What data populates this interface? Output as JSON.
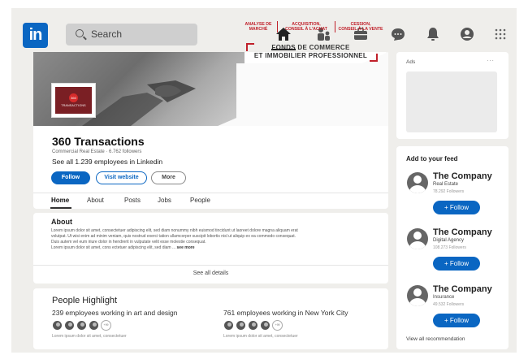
{
  "nav": {
    "logo_text": "in",
    "search_placeholder": "Search",
    "icons": [
      "home-icon",
      "my-network-icon",
      "jobs-icon",
      "messaging-icon",
      "notifications-icon",
      "profile-icon",
      "apps-grid-icon"
    ]
  },
  "banner": {
    "services": [
      "ANALYSE DE\nMARCHÉ",
      "ACQUISITION,\nCONSEIL À L'ACHAT",
      "CESSION,\nCONSEIL À LA VENTE"
    ],
    "headline_line1": "FONDS DE COMMERCE",
    "headline_line2": "ET IMMOBILIER PROFESSIONNEL"
  },
  "company": {
    "logo_mark": "360",
    "logo_word": "TRANSACTIONS",
    "name": "360 Transactions",
    "subtitle": "Commercial Real Estate · 6.762 followers",
    "employees_link": "See all 1.239 employees in Linkedin",
    "follow_label": "Follow",
    "visit_label": "Visit website",
    "more_label": "More"
  },
  "tabs": [
    "Home",
    "About",
    "Posts",
    "Jobs",
    "People"
  ],
  "about": {
    "title": "About",
    "line1": "Lorem ipsum dolor sit amet, consectetuer adipiscing elit, sed diam nonummy nibh euismod tincidunt ut laoreet dolore magna aliquam erat",
    "line2": "volutpat. Ut wisi enim ad minim veniam, quis nostrud exerci tation ullamcorper suscipit lobortis nisl ut aliquip ex ea commodo consequat.",
    "line3": "Duis autem vel eum iriure dolor in hendrerit in vulputate velit esse molestie consequat.",
    "line4": "Lorem ipsum dolor sit amet, cons ectetuer adipiscing elit, sed diam ...",
    "see_more": "see more",
    "see_all": "See all details"
  },
  "people": {
    "title": "People Highlight",
    "left_text": "239 employees working in art and design",
    "right_text": "761 employees working in New York City",
    "more_badge": "+99",
    "left_small": "Lorem ipsum dolor sit amet, consectetuer",
    "right_small": "Lorem ipsum dolor sit amet, consectetuer"
  },
  "ads": {
    "title": "Ads",
    "menu": "···"
  },
  "feed": {
    "title": "Add to your feed",
    "items": [
      {
        "name": "The Company",
        "category": "Real Estate",
        "followers": "78.292 Followers",
        "button": "+   Follow"
      },
      {
        "name": "The Company",
        "category": "Digital Agency",
        "followers": "108.273 Followers",
        "button": "+   Follow"
      },
      {
        "name": "The Company",
        "category": "Insurance",
        "followers": "49.532 Followers",
        "button": "+   Follow"
      }
    ],
    "view_all": "View all recommendation"
  },
  "colors": {
    "brand": "#0a66c2",
    "accent_red": "#c0202a",
    "background": "#efeeeb"
  }
}
